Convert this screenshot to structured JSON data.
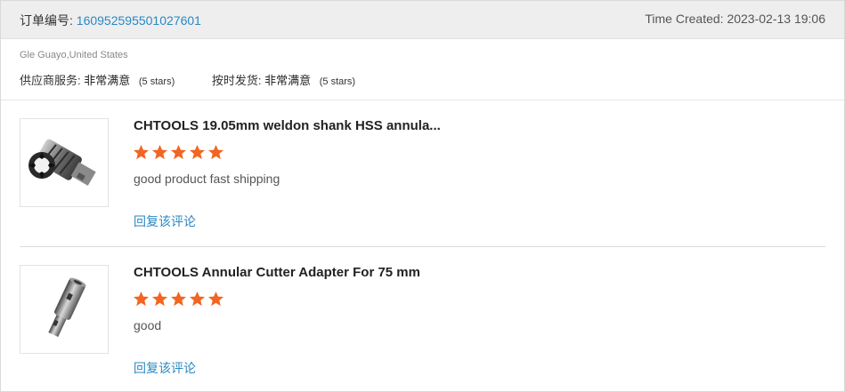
{
  "order": {
    "label": "订单编号:",
    "number": "160952595501027601",
    "time_label": "Time Created:",
    "time_value": "2023-02-13 19:06"
  },
  "buyer": {
    "location": "Gle Guayo,United States"
  },
  "ratings": [
    {
      "label": "供应商服务:",
      "value": "非常满意",
      "stars": "(5 stars)"
    },
    {
      "label": "按时发货:",
      "value": "非常满意",
      "stars": "(5 stars)"
    }
  ],
  "items": [
    {
      "name": "CHTOOLS 19.05mm weldon shank HSS annula...",
      "rating": 5,
      "comment": "good product fast shipping",
      "reply_label": "回复该评论",
      "thumbnail_icon": "annular-cutter-icon"
    },
    {
      "name": "CHTOOLS Annular Cutter Adapter For 75 mm",
      "rating": 5,
      "comment": "good",
      "reply_label": "回复该评论",
      "thumbnail_icon": "cutter-adapter-icon"
    }
  ],
  "colors": {
    "link": "#2a88c2",
    "star": "#f26522",
    "header_bg": "#eeeeee"
  }
}
